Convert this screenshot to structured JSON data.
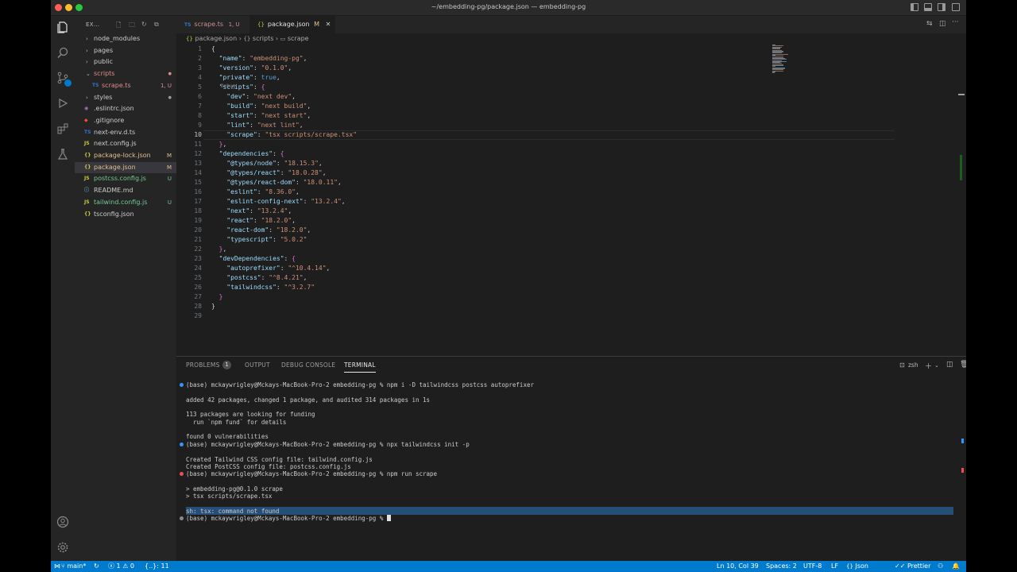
{
  "window": {
    "title": "~/embedding-pg/package.json — embedding-pg"
  },
  "colors": {
    "accent": "#007acc",
    "modified": "#e2c08d",
    "untracked": "#73c991",
    "error": "#f14c4c"
  },
  "activity_bar": {
    "icons": [
      "explorer-icon",
      "search-icon",
      "source-control-icon",
      "run-debug-icon",
      "extensions-icon",
      "testing-icon",
      "account-icon",
      "manage-gear-icon"
    ]
  },
  "sidebar": {
    "header": "EX...",
    "tree": [
      {
        "name": "node_modules",
        "type": "folder",
        "indent": 1,
        "open": false,
        "badge": ""
      },
      {
        "name": "pages",
        "type": "folder",
        "indent": 1,
        "open": false,
        "badge": ""
      },
      {
        "name": "public",
        "type": "folder",
        "indent": 1,
        "open": false,
        "badge": ""
      },
      {
        "name": "scripts",
        "type": "folder",
        "indent": 1,
        "open": true,
        "badge": ""
      },
      {
        "name": "scrape.ts",
        "type": "ts",
        "indent": 2,
        "badge": "1, U"
      },
      {
        "name": "styles",
        "type": "folder",
        "indent": 1,
        "open": false,
        "badge": ""
      },
      {
        "name": ".eslintrc.json",
        "type": "eslint",
        "indent": 1,
        "badge": ""
      },
      {
        "name": ".gitignore",
        "type": "git",
        "indent": 1,
        "badge": ""
      },
      {
        "name": "next-env.d.ts",
        "type": "ts",
        "indent": 1,
        "badge": ""
      },
      {
        "name": "next.config.js",
        "type": "js",
        "indent": 1,
        "badge": ""
      },
      {
        "name": "package-lock.json",
        "type": "json",
        "indent": 1,
        "badge": "M"
      },
      {
        "name": "package.json",
        "type": "json",
        "indent": 1,
        "badge": "M"
      },
      {
        "name": "postcss.config.js",
        "type": "js",
        "indent": 1,
        "badge": "U"
      },
      {
        "name": "README.md",
        "type": "md",
        "indent": 1,
        "badge": ""
      },
      {
        "name": "tailwind.config.js",
        "type": "js",
        "indent": 1,
        "badge": "U"
      },
      {
        "name": "tsconfig.json",
        "type": "json",
        "indent": 1,
        "badge": ""
      }
    ]
  },
  "tabs": [
    {
      "icon": "TS",
      "label": "scrape.ts",
      "badge": "1, U",
      "active": false
    },
    {
      "icon": "{}",
      "label": "package.json",
      "badge": "M",
      "active": true
    }
  ],
  "breadcrumb": [
    "package.json",
    "scripts",
    "scrape"
  ],
  "editor": {
    "current_line": 10,
    "codelens": "Debug",
    "lines": [
      [
        [
          "p",
          "{"
        ]
      ],
      [
        [
          "p",
          "  "
        ],
        [
          "k",
          "\"name\""
        ],
        [
          "p",
          ": "
        ],
        [
          "s",
          "\"embedding-pg\""
        ],
        [
          "p",
          ","
        ]
      ],
      [
        [
          "p",
          "  "
        ],
        [
          "k",
          "\"version\""
        ],
        [
          "p",
          ": "
        ],
        [
          "s",
          "\"0.1.0\""
        ],
        [
          "p",
          ","
        ]
      ],
      [
        [
          "p",
          "  "
        ],
        [
          "k",
          "\"private\""
        ],
        [
          "p",
          ": "
        ],
        [
          "kw",
          "true"
        ],
        [
          "p",
          ","
        ]
      ],
      [
        [
          "p",
          "  "
        ],
        [
          "k",
          "\"scripts\""
        ],
        [
          "p",
          ": "
        ],
        [
          "b",
          "{"
        ]
      ],
      [
        [
          "p",
          "    "
        ],
        [
          "k",
          "\"dev\""
        ],
        [
          "p",
          ": "
        ],
        [
          "s",
          "\"next dev\""
        ],
        [
          "p",
          ","
        ]
      ],
      [
        [
          "p",
          "    "
        ],
        [
          "k",
          "\"build\""
        ],
        [
          "p",
          ": "
        ],
        [
          "s",
          "\"next build\""
        ],
        [
          "p",
          ","
        ]
      ],
      [
        [
          "p",
          "    "
        ],
        [
          "k",
          "\"start\""
        ],
        [
          "p",
          ": "
        ],
        [
          "s",
          "\"next start\""
        ],
        [
          "p",
          ","
        ]
      ],
      [
        [
          "p",
          "    "
        ],
        [
          "k",
          "\"lint\""
        ],
        [
          "p",
          ": "
        ],
        [
          "s",
          "\"next lint\""
        ],
        [
          "p",
          ","
        ]
      ],
      [
        [
          "p",
          "    "
        ],
        [
          "k",
          "\"scrape\""
        ],
        [
          "p",
          ": "
        ],
        [
          "s",
          "\"tsx scripts/scrape.tsx\""
        ]
      ],
      [
        [
          "p",
          "  "
        ],
        [
          "b",
          "}"
        ],
        [
          "p",
          ","
        ]
      ],
      [
        [
          "p",
          "  "
        ],
        [
          "k",
          "\"dependencies\""
        ],
        [
          "p",
          ": "
        ],
        [
          "b",
          "{"
        ]
      ],
      [
        [
          "p",
          "    "
        ],
        [
          "k",
          "\"@types/node\""
        ],
        [
          "p",
          ": "
        ],
        [
          "s",
          "\"18.15.3\""
        ],
        [
          "p",
          ","
        ]
      ],
      [
        [
          "p",
          "    "
        ],
        [
          "k",
          "\"@types/react\""
        ],
        [
          "p",
          ": "
        ],
        [
          "s",
          "\"18.0.28\""
        ],
        [
          "p",
          ","
        ]
      ],
      [
        [
          "p",
          "    "
        ],
        [
          "k",
          "\"@types/react-dom\""
        ],
        [
          "p",
          ": "
        ],
        [
          "s",
          "\"18.0.11\""
        ],
        [
          "p",
          ","
        ]
      ],
      [
        [
          "p",
          "    "
        ],
        [
          "k",
          "\"eslint\""
        ],
        [
          "p",
          ": "
        ],
        [
          "s",
          "\"8.36.0\""
        ],
        [
          "p",
          ","
        ]
      ],
      [
        [
          "p",
          "    "
        ],
        [
          "k",
          "\"eslint-config-next\""
        ],
        [
          "p",
          ": "
        ],
        [
          "s",
          "\"13.2.4\""
        ],
        [
          "p",
          ","
        ]
      ],
      [
        [
          "p",
          "    "
        ],
        [
          "k",
          "\"next\""
        ],
        [
          "p",
          ": "
        ],
        [
          "s",
          "\"13.2.4\""
        ],
        [
          "p",
          ","
        ]
      ],
      [
        [
          "p",
          "    "
        ],
        [
          "k",
          "\"react\""
        ],
        [
          "p",
          ": "
        ],
        [
          "s",
          "\"18.2.0\""
        ],
        [
          "p",
          ","
        ]
      ],
      [
        [
          "p",
          "    "
        ],
        [
          "k",
          "\"react-dom\""
        ],
        [
          "p",
          ": "
        ],
        [
          "s",
          "\"18.2.0\""
        ],
        [
          "p",
          ","
        ]
      ],
      [
        [
          "p",
          "    "
        ],
        [
          "k",
          "\"typescript\""
        ],
        [
          "p",
          ": "
        ],
        [
          "s",
          "\"5.0.2\""
        ]
      ],
      [
        [
          "p",
          "  "
        ],
        [
          "b",
          "}"
        ],
        [
          "p",
          ","
        ]
      ],
      [
        [
          "p",
          "  "
        ],
        [
          "k",
          "\"devDependencies\""
        ],
        [
          "p",
          ": "
        ],
        [
          "b",
          "{"
        ]
      ],
      [
        [
          "p",
          "    "
        ],
        [
          "k",
          "\"autoprefixer\""
        ],
        [
          "p",
          ": "
        ],
        [
          "s",
          "\"^10.4.14\""
        ],
        [
          "p",
          ","
        ]
      ],
      [
        [
          "p",
          "    "
        ],
        [
          "k",
          "\"postcss\""
        ],
        [
          "p",
          ": "
        ],
        [
          "s",
          "\"^8.4.21\""
        ],
        [
          "p",
          ","
        ]
      ],
      [
        [
          "p",
          "    "
        ],
        [
          "k",
          "\"tailwindcss\""
        ],
        [
          "p",
          ": "
        ],
        [
          "s",
          "\"^3.2.7\""
        ]
      ],
      [
        [
          "p",
          "  "
        ],
        [
          "b",
          "}"
        ]
      ],
      [
        [
          "p",
          "}"
        ]
      ],
      [
        [
          "p",
          ""
        ]
      ]
    ]
  },
  "panel": {
    "tabs": [
      {
        "label": "PROBLEMS",
        "badge": "1",
        "active": false
      },
      {
        "label": "OUTPUT",
        "active": false
      },
      {
        "label": "DEBUG CONSOLE",
        "active": false
      },
      {
        "label": "TERMINAL",
        "active": true
      }
    ],
    "shell_label": "zsh",
    "terminal_lines": [
      {
        "text": "(base) mckaywrigley@Mckays-MacBook-Pro-2 embedding-pg % npm i -D tailwindcss postcss autoprefixer",
        "dot": "blue"
      },
      {
        "text": "",
        "dot": ""
      },
      {
        "text": "added 42 packages, changed 1 package, and audited 314 packages in 1s",
        "dot": ""
      },
      {
        "text": "",
        "dot": ""
      },
      {
        "text": "113 packages are looking for funding",
        "dot": ""
      },
      {
        "text": "  run `npm fund` for details",
        "dot": ""
      },
      {
        "text": "",
        "dot": ""
      },
      {
        "text": "found 0 vulnerabilities",
        "dot": ""
      },
      {
        "text": "(base) mckaywrigley@Mckays-MacBook-Pro-2 embedding-pg % npx tailwindcss init -p",
        "dot": "blue"
      },
      {
        "text": "",
        "dot": ""
      },
      {
        "text": "Created Tailwind CSS config file: tailwind.config.js",
        "dot": ""
      },
      {
        "text": "Created PostCSS config file: postcss.config.js",
        "dot": ""
      },
      {
        "text": "(base) mckaywrigley@Mckays-MacBook-Pro-2 embedding-pg % npm run scrape",
        "dot": "red"
      },
      {
        "text": "",
        "dot": ""
      },
      {
        "text": "> embedding-pg@0.1.0 scrape",
        "dot": ""
      },
      {
        "text": "> tsx scripts/scrape.tsx",
        "dot": ""
      },
      {
        "text": "",
        "dot": ""
      },
      {
        "text": "sh: tsx: command not found",
        "dot": "",
        "selected": true
      },
      {
        "text": "(base) mckaywrigley@Mckays-MacBook-Pro-2 embedding-pg % ",
        "dot": "gray",
        "cursor": true
      }
    ]
  },
  "status_bar": {
    "branch": "main*",
    "errors": "1",
    "warnings": "0",
    "brace_info": "{..}: 11",
    "position": "Ln 10, Col 39",
    "spaces": "Spaces: 2",
    "encoding": "UTF-8",
    "eol": "LF",
    "language": "Json",
    "formatter": "Prettier"
  }
}
